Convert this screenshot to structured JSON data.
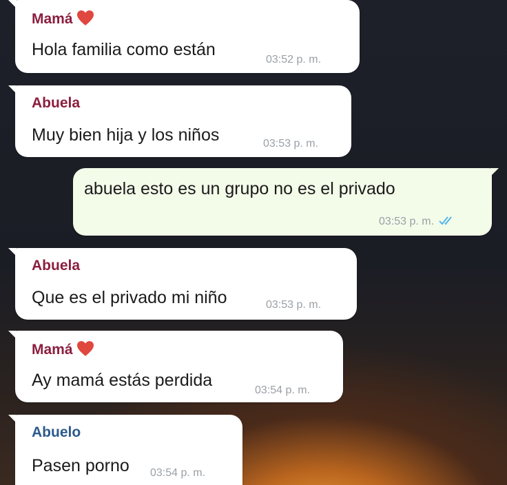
{
  "messages": [
    {
      "sender": "Mamá",
      "sender_color": "#8b1e3f",
      "has_heart": true,
      "text": "Hola familia como están",
      "time": "03:52 p. m."
    },
    {
      "sender": "Abuela",
      "sender_color": "#8b1e3f",
      "has_heart": false,
      "text": "Muy bien hija y los niños",
      "time": "03:53 p. m."
    },
    {
      "outgoing": true,
      "text": "abuela esto es un grupo no es el privado",
      "time": "03:53 p. m.",
      "status_icon": "double-check-icon",
      "status_color": "#4fb6ec"
    },
    {
      "sender": "Abuela",
      "sender_color": "#8b1e3f",
      "has_heart": false,
      "text": "Que es el privado mi niño",
      "time": "03:53 p. m."
    },
    {
      "sender": "Mamá",
      "sender_color": "#8b1e3f",
      "has_heart": true,
      "text": "Ay mamá estás perdida",
      "time": "03:54 p. m."
    },
    {
      "sender": "Abuelo",
      "sender_color": "#2c5a8c",
      "has_heart": false,
      "text": "Pasen porno",
      "time": "03:54 p. m."
    }
  ],
  "heart_color": "#e0473f"
}
